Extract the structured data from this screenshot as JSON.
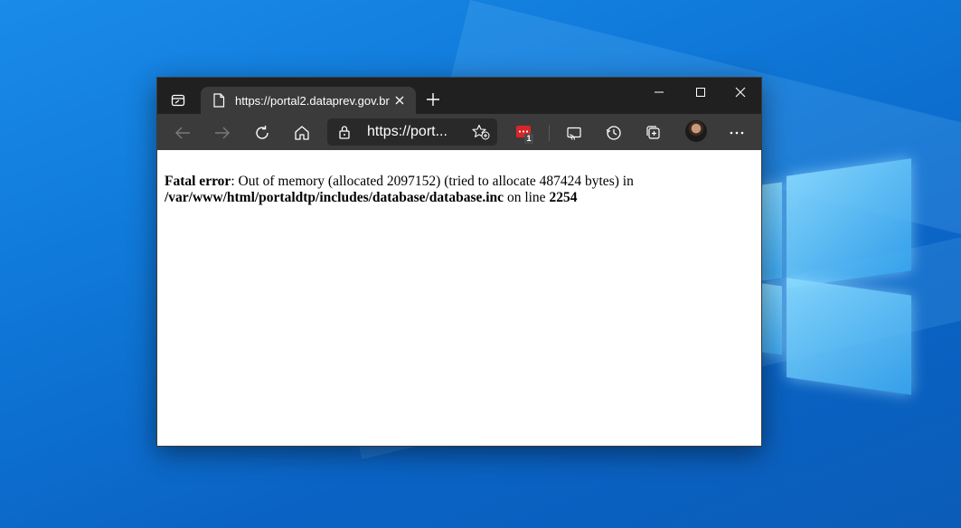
{
  "browser": {
    "tab": {
      "title": "https://portal2.dataprev.gov.br"
    },
    "address_bar": {
      "url_display": "https://port..."
    },
    "extension_badge": "1"
  },
  "page": {
    "error_label": "Fatal error",
    "error_message": ": Out of memory (allocated 2097152) (tried to allocate 487424 bytes) in",
    "file_path": "/var/www/html/portaldtp/includes/database/database.inc",
    "line_prefix": " on line ",
    "line_number": "2254"
  },
  "colors": {
    "titlebar": "#202020",
    "toolbar": "#3b3b3b",
    "extension_red": "#d7262a",
    "desktop_blue": "#0f78d8"
  },
  "icons": [
    "tab-actions-icon",
    "page-icon",
    "close-icon",
    "plus-icon",
    "minimize-icon",
    "maximize-icon",
    "back-icon",
    "forward-icon",
    "refresh-icon",
    "home-icon",
    "lock-icon",
    "add-favorite-icon",
    "extension-icon",
    "cast-icon",
    "history-icon",
    "collections-icon",
    "avatar",
    "more-icon"
  ]
}
